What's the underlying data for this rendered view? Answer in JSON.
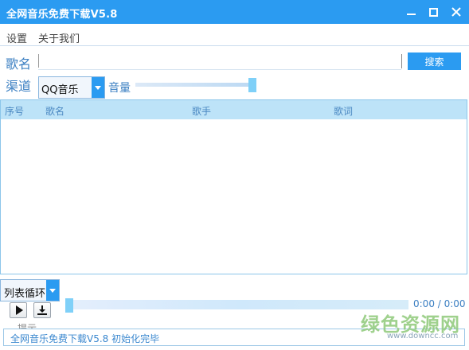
{
  "window": {
    "title": "全网音乐免费下载V5.8",
    "title_bar_color": "#2b9bf1"
  },
  "menu": {
    "items": [
      {
        "label": "设置"
      },
      {
        "label": "关于我们"
      }
    ]
  },
  "search": {
    "song_label": "歌名",
    "song_value": "",
    "button_label": "搜索"
  },
  "channel": {
    "label": "渠道",
    "selected": "QQ音乐"
  },
  "volume": {
    "label": "音量",
    "level": 1.0
  },
  "list": {
    "columns": [
      "序号",
      "歌名",
      "歌手",
      "歌词"
    ],
    "rows": []
  },
  "player": {
    "play_mode": "列表循环",
    "progress": 0.0,
    "time": "0:00 / 0:00",
    "hint": "提示"
  },
  "status": {
    "text": "全网音乐免费下载V5.8 初始化完毕"
  },
  "watermark": {
    "brand": "绿色资源网",
    "url": "www.downcc.com"
  }
}
